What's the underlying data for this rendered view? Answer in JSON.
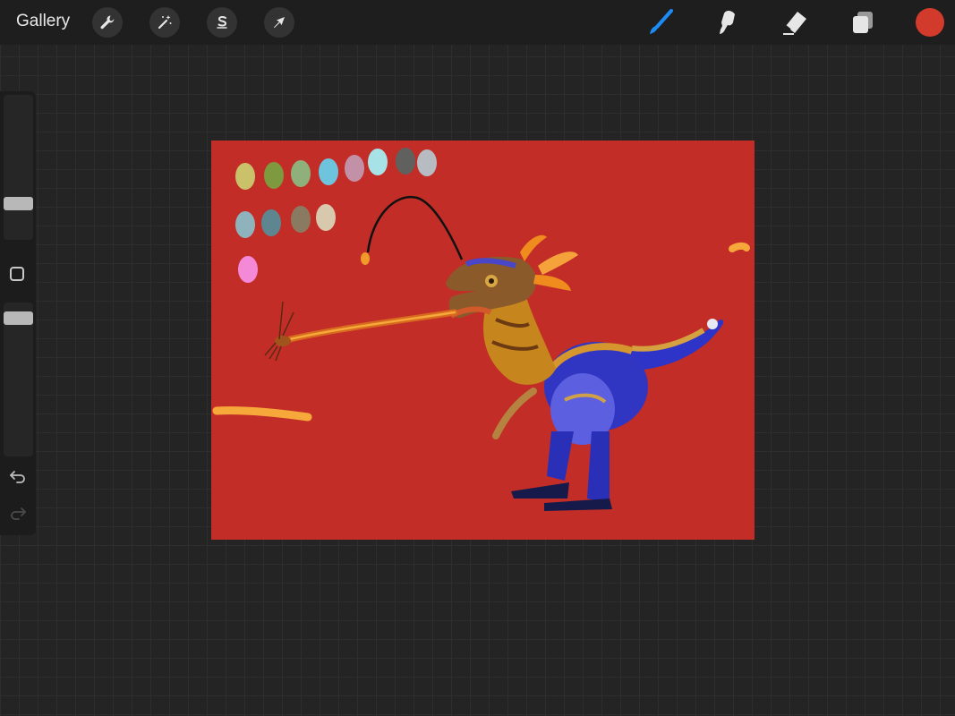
{
  "topbar": {
    "gallery_label": "Gallery",
    "tools_left": [
      {
        "icon": "wrench-icon"
      },
      {
        "icon": "magic-wand-icon"
      },
      {
        "icon": "selection-s-icon"
      },
      {
        "icon": "move-arrow-icon"
      }
    ],
    "tools_right": [
      {
        "icon": "brush-icon",
        "active": true
      },
      {
        "icon": "smudge-icon"
      },
      {
        "icon": "eraser-icon"
      },
      {
        "icon": "layers-icon"
      }
    ],
    "current_color": "#d23a2c"
  },
  "sidebar": {
    "brush_size_icon": "brush-size-slider",
    "opacity_icon": "brush-opacity-slider",
    "modify_icon": "square-modify-icon",
    "undo_icon": "undo-icon",
    "redo_icon": "redo-icon"
  },
  "canvas": {
    "background_color": "#c22e27",
    "artwork": "dinosaur-anglerfish-painting",
    "palette_swatches": [
      "#c9c26a",
      "#7e9a3e",
      "#8fb07a",
      "#6ec4dc",
      "#c291a8",
      "#a7e3e6",
      "#60605f",
      "#b6bcc1",
      "#8fb3bd",
      "#5d8690",
      "#8a7a62",
      "#d8c9ae",
      "#f48ad7"
    ],
    "accent_stroke_color": "#f6a93a"
  }
}
